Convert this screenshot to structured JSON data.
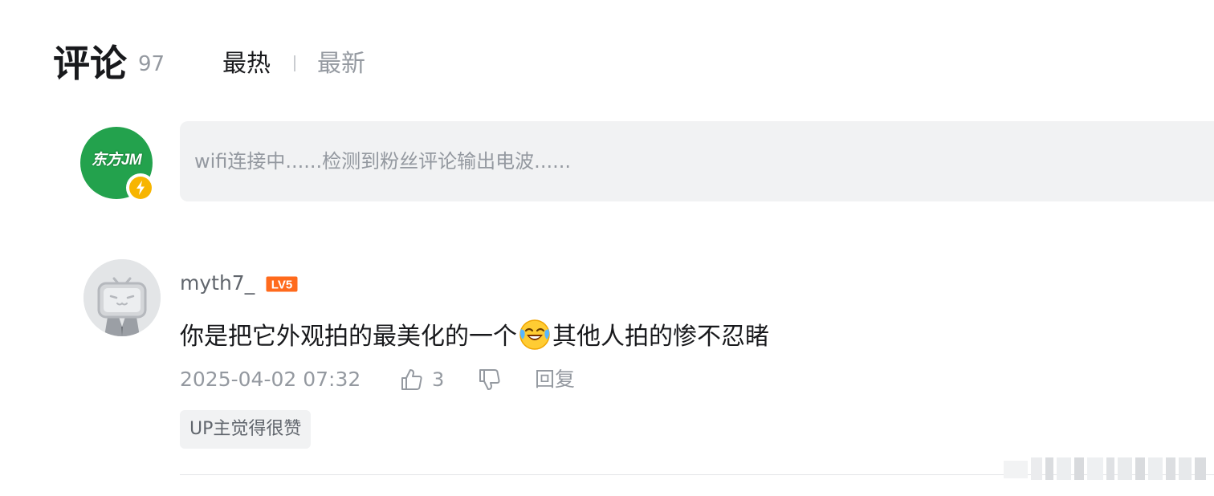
{
  "header": {
    "title": "评论",
    "count": "97",
    "sort_tabs": [
      {
        "label": "最热",
        "active": true
      },
      {
        "label": "最新",
        "active": false
      }
    ]
  },
  "composer": {
    "avatar_text": "东方JM",
    "avatar_color": "#23a24d",
    "badge_icon": "lightning-bolt-icon",
    "placeholder": "wifi连接中......检测到粉丝评论输出电波......"
  },
  "comment": {
    "username": "myth7_",
    "level": "LV5",
    "level_color": "#ff6a1c",
    "avatar_icon": "bilibili-tv-mascot-icon",
    "text_before_emoji": "你是把它外观拍的最美化的一个",
    "emoji": "laughing-crying-emoji",
    "text_after_emoji": "其他人拍的惨不忍睹",
    "timestamp": "2025-04-02 07:32",
    "like_count": "3",
    "reply_label": "回复",
    "up_tag": "UP主觉得很赞"
  }
}
